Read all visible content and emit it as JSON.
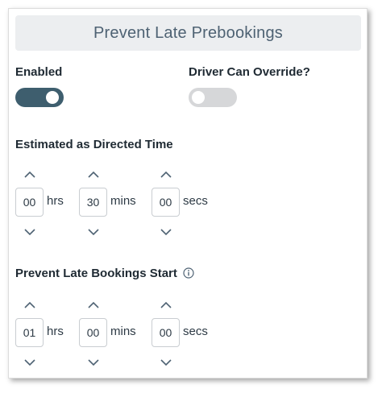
{
  "header": {
    "title": "Prevent Late Prebookings"
  },
  "enabled": {
    "label": "Enabled",
    "state": true
  },
  "driver_override": {
    "label": "Driver Can Override?",
    "state": false
  },
  "estimated": {
    "label": "Estimated as Directed Time",
    "hours": "00",
    "hours_label": "hrs",
    "minutes": "30",
    "minutes_label": "mins",
    "seconds": "00",
    "seconds_label": "secs"
  },
  "prevent_start": {
    "label": "Prevent Late Bookings Start",
    "hours": "01",
    "hours_label": "hrs",
    "minutes": "00",
    "minutes_label": "mins",
    "seconds": "00",
    "seconds_label": "secs"
  },
  "colors": {
    "toggle_on": "#3e5e6e",
    "toggle_off": "#d6d7d9",
    "header_bg": "#eceef0",
    "header_text": "#4e6273"
  }
}
